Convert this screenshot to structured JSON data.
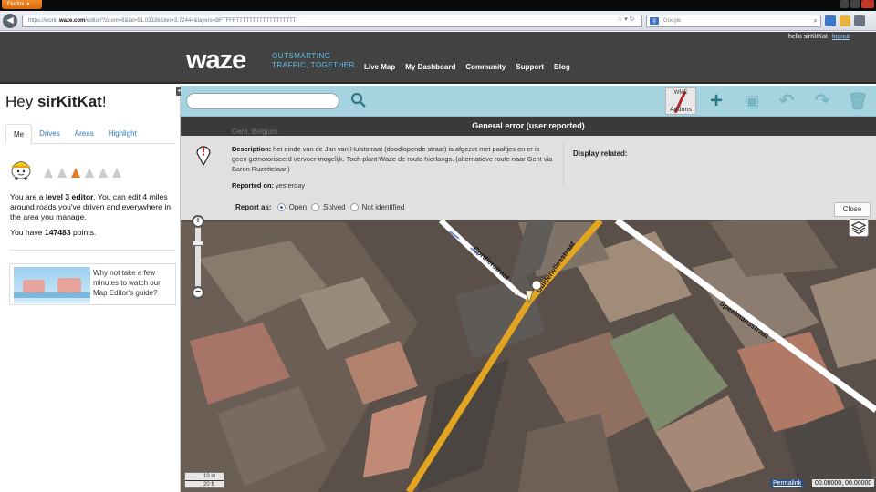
{
  "browser": {
    "app_button": "Firefox",
    "url_prefix": "https://world.",
    "url_domain": "waze.com",
    "url_rest": "/editor/?zoom=8&lat=51.03336&lon=3.72444&layers=BFTFFFTTTTTTTTTTTTTTTTTT",
    "search_placeholder": "Google"
  },
  "header": {
    "greeting": "hello sirKitKat",
    "logout": "logout",
    "logo": "waze",
    "tagline_1": "OUTSMARTING",
    "tagline_2": "TRAFFIC, TOGETHER.",
    "nav": [
      "Live Map",
      "My Dashboard",
      "Community",
      "Support",
      "Blog"
    ]
  },
  "sidebar": {
    "greeting_prefix": "Hey ",
    "username": "sirKitKat",
    "greeting_suffix": "!",
    "tabs": [
      "Me",
      "Drives",
      "Areas",
      "Highlight"
    ],
    "active_tab": "Me",
    "level_text_1": "You are a ",
    "level_text_bold": "level 3 editor",
    "level_text_2": ", You can edit 4 miles around roads you've driven and everywhere in the area you manage.",
    "points_prefix": "You have ",
    "points": "147483",
    "points_suffix": " points.",
    "editor_level": 3,
    "editor_level_max": 6,
    "guide_text": "Why not take a few minutes to watch our Map Editor's guide?"
  },
  "toolbar": {
    "wme_top": "WME",
    "wme_bottom": "Addons"
  },
  "error_panel": {
    "title": "General error (user reported)",
    "location": "Gent, Belgium",
    "description_label": "Description:",
    "description": " het einde van de Jan van Hulststraat (doodlopende straat) is afgezet met paaltjes en er is geen gemotoriseerd vervoer mogelijk. Toch plant Waze de route hierlangs. (alternatieve route naar Gent via Baron Ruzettelaan)",
    "reported_label": "Reported on:",
    "reported_value": " yesterday",
    "display_related": "Display related:",
    "report_as_label": "Report as:",
    "options": [
      "Open",
      "Solved",
      "Not identified"
    ],
    "selected_option": "Open",
    "close_label": "Close"
  },
  "map": {
    "streets": [
      "Cordierstraat",
      "Guldenvliesstraat",
      "Speelmansstraat"
    ],
    "scale_top": "10 m",
    "scale_bottom": "20 ft",
    "permalink": "Permalink",
    "coords": "00.00000, 00.00000"
  },
  "colors": {
    "header_bg": "#424242",
    "tagline": "#5fc1e8",
    "toolbar_bg": "#a7d3e0",
    "link": "#2a7bbd",
    "road_highlight": "#e3a41f"
  }
}
